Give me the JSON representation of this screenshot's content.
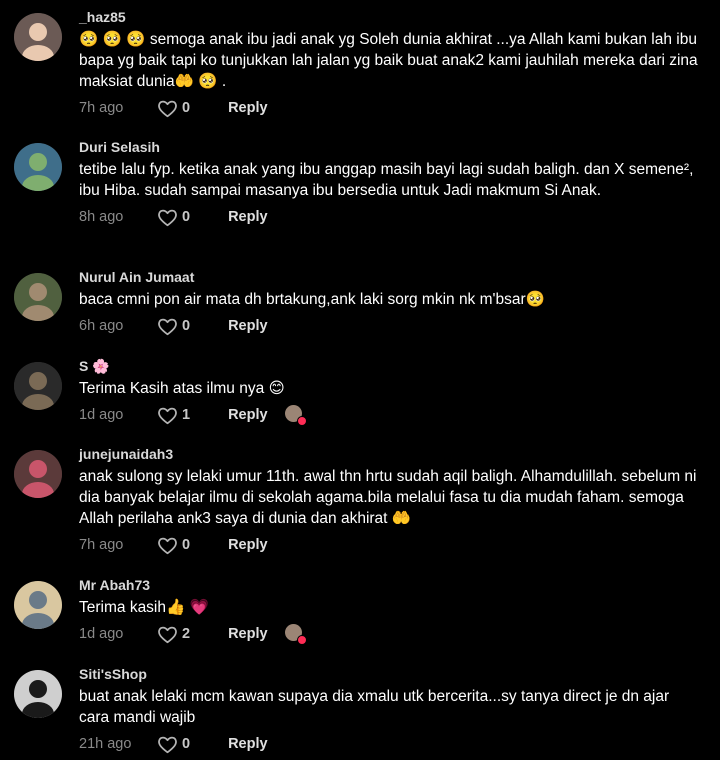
{
  "comments": [
    {
      "username": "_haz85",
      "text": "🥺 🥺 🥺 semoga anak ibu jadi anak yg Soleh dunia akhirat ...ya Allah kami bukan lah ibu bapa yg baik tapi ko tunjukkan lah jalan yg baik buat anak2 kami jauhilah mereka dari zina maksiat dunia🤲 🥺 .",
      "time": "7h ago",
      "likes": "0",
      "reply": "Reply"
    },
    {
      "username": "Duri Selasih",
      "text": "tetibe lalu fyp. ketika anak yang ibu anggap masih bayi lagi sudah baligh. dan X semene², ibu Hiba. sudah sampai masanya ibu bersedia untuk Jadi makmum Si Anak.",
      "time": "8h ago",
      "likes": "0",
      "reply": "Reply"
    },
    {
      "username": "Nurul Ain Jumaat",
      "text": "baca cmni pon air mata dh brtakung,ank laki sorg mkin nk m'bsar🥺",
      "time": "6h ago",
      "likes": "0",
      "reply": "Reply"
    },
    {
      "username": "S 🌸",
      "text": "Terima Kasih atas ilmu nya 😊",
      "time": "1d ago",
      "likes": "1",
      "reply": "Reply",
      "creator_liked": true
    },
    {
      "username": "junejunaidah3",
      "text": "anak sulong sy lelaki umur 11th. awal thn hrtu sudah aqil baligh. Alhamdulillah. sebelum ni dia banyak belajar ilmu di sekolah agama.bila melalui fasa tu dia mudah faham. semoga Allah perilaha ank3 saya di dunia dan akhirat 🤲",
      "time": "7h ago",
      "likes": "0",
      "reply": "Reply"
    },
    {
      "username": "Mr Abah73",
      "text": "Terima kasih👍 💗",
      "time": "1d ago",
      "likes": "2",
      "reply": "Reply",
      "creator_liked": true
    },
    {
      "username": "Siti'sShop",
      "text": "buat anak lelaki mcm kawan supaya dia xmalu utk bercerita...sy tanya direct je dn ajar cara mandi wajib",
      "time": "21h ago",
      "likes": "0",
      "reply": "Reply"
    }
  ],
  "icons": {
    "like": "heart-outline-icon",
    "creator_like": "creator-liked-badge"
  },
  "colors": {
    "background": "#000000",
    "username": "#d9d9d9",
    "text": "#ffffff",
    "meta": "#8a8a8a",
    "creator_heart": "#fe2c55"
  }
}
